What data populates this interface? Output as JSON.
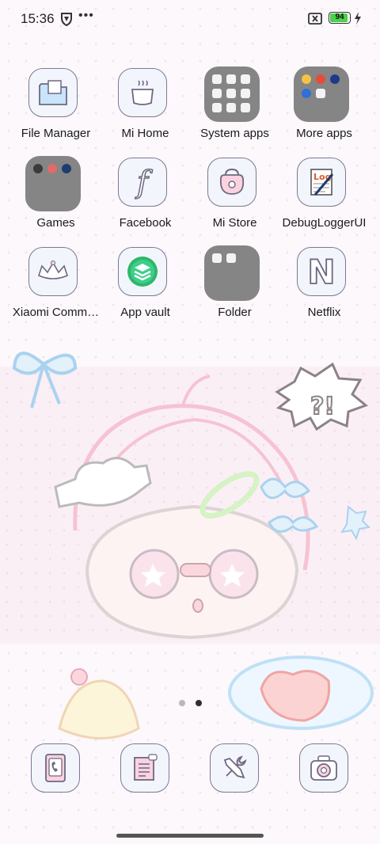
{
  "status_bar": {
    "time": "15:36",
    "more_indicator": "•••",
    "battery_level": 94,
    "battery_text": "94",
    "battery_color": "#4bd24b",
    "icons": [
      "shield-icon",
      "no-sim-icon",
      "battery-icon",
      "charging-bolt-icon"
    ]
  },
  "apps": [
    {
      "label": "File Manager",
      "icon": "folder-files-icon"
    },
    {
      "label": "Mi Home",
      "icon": "cup-icon"
    },
    {
      "label": "System apps",
      "icon": "folder-icon"
    },
    {
      "label": "More apps",
      "icon": "folder-icon"
    },
    {
      "label": "Games",
      "icon": "folder-icon"
    },
    {
      "label": "Facebook",
      "icon": "facebook-icon"
    },
    {
      "label": "Mi Store",
      "icon": "shopping-bag-icon"
    },
    {
      "label": "DebugLoggerUI",
      "icon": "log-icon"
    },
    {
      "label": "Xiaomi Comm…",
      "icon": "crown-icon"
    },
    {
      "label": "App vault",
      "icon": "layers-icon"
    },
    {
      "label": "Folder",
      "icon": "folder-icon"
    },
    {
      "label": "Netflix",
      "icon": "netflix-icon"
    }
  ],
  "log_badge": "Log",
  "netflix_letter": "N",
  "facebook_letter": "f",
  "page_indicator": {
    "pages": 2,
    "current": 2
  },
  "dock": [
    {
      "icon": "phone-icon"
    },
    {
      "icon": "notes-icon"
    },
    {
      "icon": "tools-icon"
    },
    {
      "icon": "camera-icon"
    }
  ],
  "wallpaper_text": "?!"
}
